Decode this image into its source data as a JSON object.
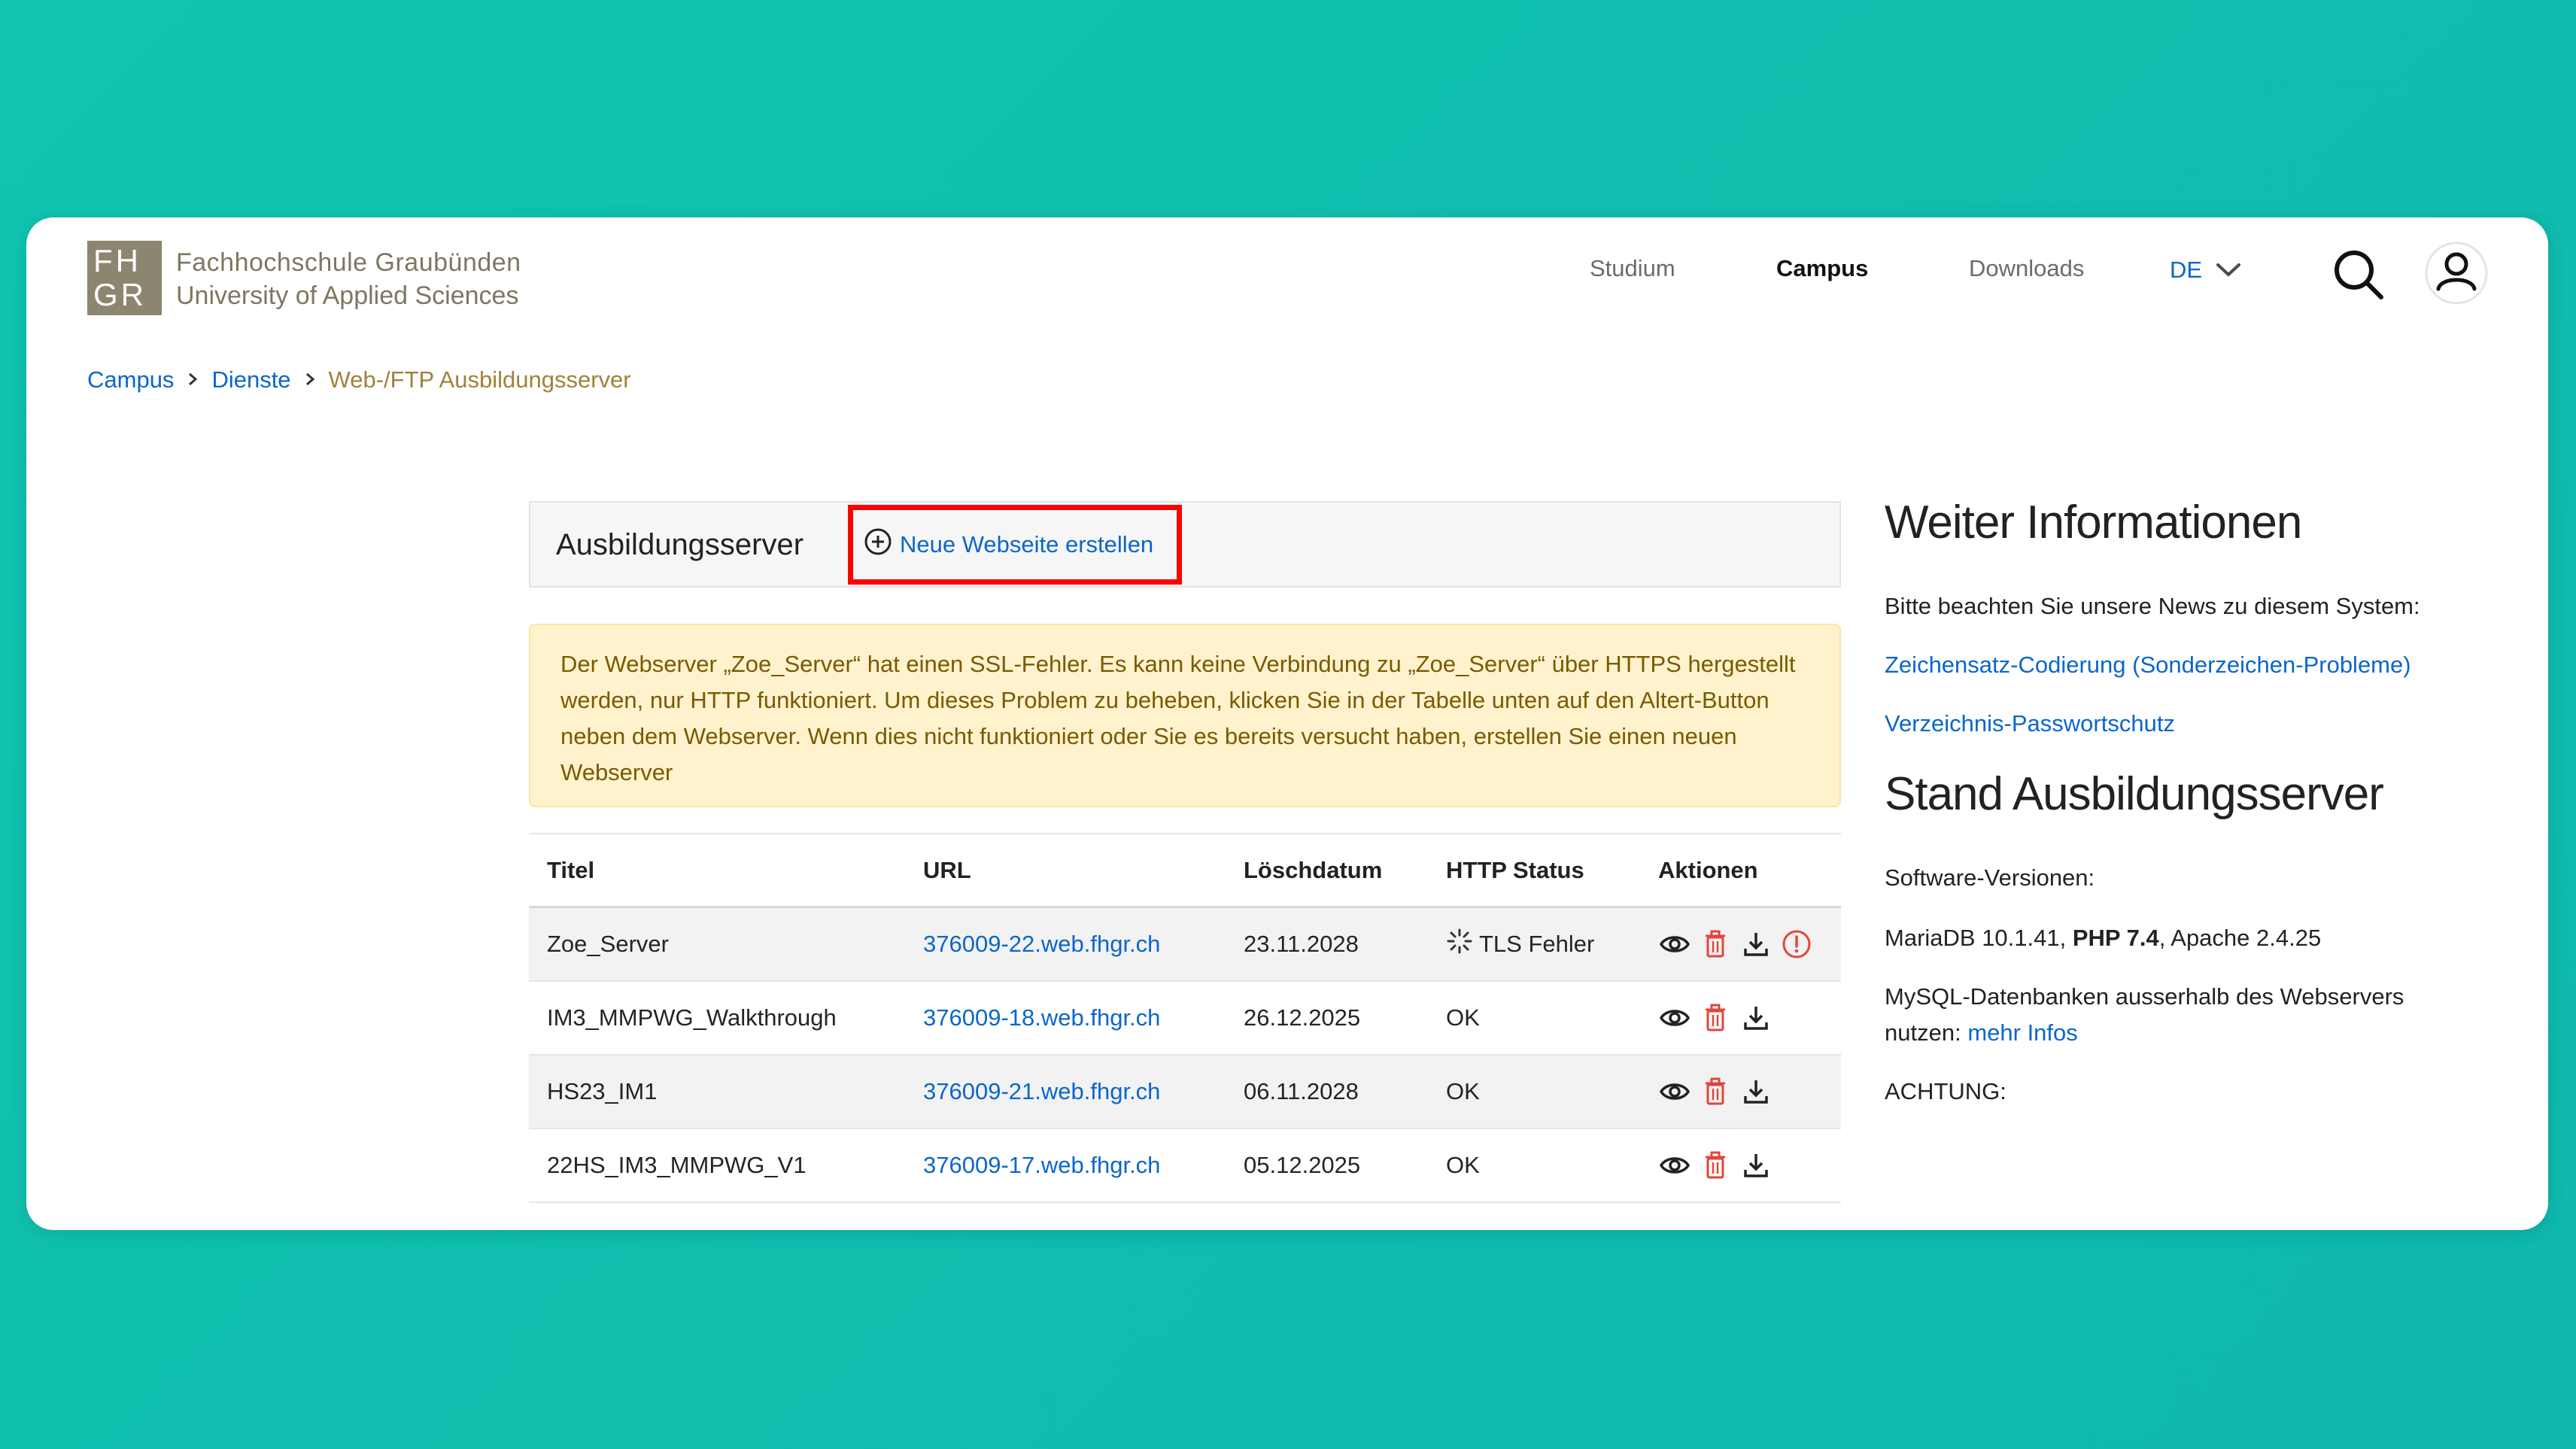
{
  "header": {
    "logo_letters_top": "FH",
    "logo_letters_bottom": "GR",
    "org_name": "Fachhochschule Graubünden",
    "org_subtitle": "University of Applied Sciences",
    "nav": [
      {
        "label": "Studium",
        "active": false
      },
      {
        "label": "Campus",
        "active": true
      },
      {
        "label": "Downloads",
        "active": false
      }
    ],
    "language": "DE"
  },
  "breadcrumb": {
    "items": [
      "Campus",
      "Dienste"
    ],
    "current": "Web-/FTP Ausbildungsserver"
  },
  "panel": {
    "title": "Ausbildungsserver",
    "new_site_label": "Neue Webseite erstellen"
  },
  "alert": {
    "text": "Der Webserver „Zoe_Server“ hat einen SSL-Fehler. Es kann keine Verbindung zu „Zoe_Server“ über HTTPS hergestellt werden, nur HTTP funktioniert. Um dieses Problem zu beheben, klicken Sie in der Tabelle unten auf den Altert-Button neben dem Webserver. Wenn dies nicht funktioniert oder Sie es bereits versucht haben, erstellen Sie einen neuen Webserver"
  },
  "table": {
    "headers": {
      "title": "Titel",
      "url": "URL",
      "date": "Löschdatum",
      "status": "HTTP Status",
      "actions": "Aktionen"
    },
    "rows": [
      {
        "title": "Zoe_Server",
        "url": "376009-22.web.fhgr.ch",
        "date": "23.11.2028",
        "status": "TLS Fehler"
      },
      {
        "title": "IM3_MMPWG_Walkthrough",
        "url": "376009-18.web.fhgr.ch",
        "date": "26.12.2025",
        "status": "OK"
      },
      {
        "title": "HS23_IM1",
        "url": "376009-21.web.fhgr.ch",
        "date": "06.11.2028",
        "status": "OK"
      },
      {
        "title": "22HS_IM3_MMPWG_V1",
        "url": "376009-17.web.fhgr.ch",
        "date": "05.12.2025",
        "status": "OK"
      }
    ]
  },
  "sidebar": {
    "heading_info": "Weiter Informationen",
    "intro": "Bitte beachten Sie unsere News zu diesem System:",
    "link_charset": "Zeichensatz-Codierung (Sonderzeichen-Probleme)",
    "link_password": "Verzeichnis-Passwortschutz",
    "heading_status": "Stand Ausbildungsserver",
    "software_label": "Software-Versionen:",
    "versions_pre": "MariaDB 10.1.41,",
    "versions_bold": "PHP 7.4",
    "versions_post": ", Apache 2.4.25",
    "mysql_text": "MySQL-Datenbanken ausserhalb des Webservers nutzen:",
    "mysql_link": "mehr Infos",
    "warning": "ACHTUNG:"
  },
  "colors": {
    "background": "#10c4b0",
    "link": "#0a66cc",
    "logo": "#8c8670",
    "highlight_border": "#ff0000",
    "alert_bg": "#fff2cd",
    "delete_icon": "#e0463c"
  },
  "icons": [
    "search-icon",
    "user-icon",
    "chevron-down-icon",
    "plus-circle-icon",
    "view-icon",
    "delete-icon",
    "download-icon",
    "alert-icon",
    "loading-spinner-icon",
    "breadcrumb-chevron-icon"
  ]
}
